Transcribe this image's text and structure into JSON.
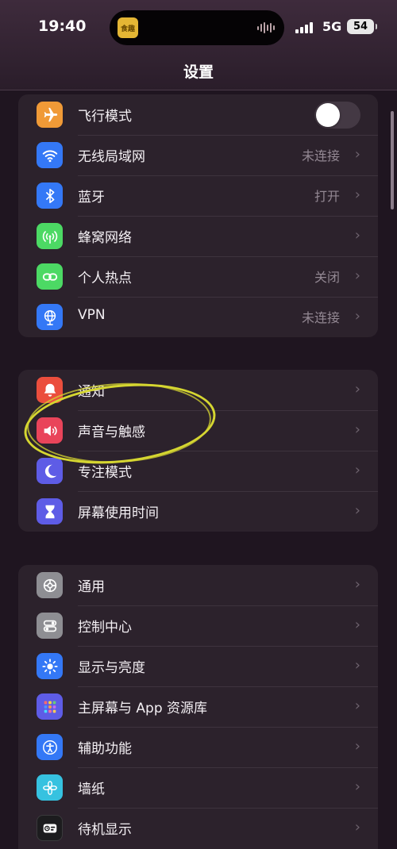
{
  "status_bar": {
    "time": "19:40",
    "island_app_label": "食趣",
    "network": "5G",
    "battery": "54"
  },
  "header": {
    "title": "设置"
  },
  "groups": [
    {
      "items": [
        {
          "label": "飞行模式",
          "icon": "airplane-icon",
          "color": "#f09a37",
          "toggle": false
        },
        {
          "label": "无线局域网",
          "value": "未连接",
          "icon": "wifi-icon",
          "color": "#3478f6"
        },
        {
          "label": "蓝牙",
          "value": "打开",
          "icon": "bluetooth-icon",
          "color": "#3478f6"
        },
        {
          "label": "蜂窝网络",
          "icon": "cellular-icon",
          "color": "#4cd964"
        },
        {
          "label": "个人热点",
          "value": "关闭",
          "icon": "hotspot-icon",
          "color": "#4cd964"
        },
        {
          "label": "VPN",
          "value": "未连接",
          "icon": "vpn-globe-icon",
          "color": "#3478f6"
        }
      ]
    },
    {
      "items": [
        {
          "label": "通知",
          "icon": "bell-icon",
          "color": "#eb4e3d"
        },
        {
          "label": "声音与触感",
          "icon": "speaker-icon",
          "color": "#e9445a"
        },
        {
          "label": "专注模式",
          "icon": "moon-icon",
          "color": "#5e5ce6"
        },
        {
          "label": "屏幕使用时间",
          "icon": "hourglass-icon",
          "color": "#5e5ce6"
        }
      ]
    },
    {
      "items": [
        {
          "label": "通用",
          "icon": "gear-icon",
          "color": "#8e8e93"
        },
        {
          "label": "控制中心",
          "icon": "control-center-icon",
          "color": "#8e8e93"
        },
        {
          "label": "显示与亮度",
          "icon": "sun-icon",
          "color": "#3478f6"
        },
        {
          "label": "主屏幕与 App 资源库",
          "icon": "home-screen-icon",
          "color": "#5e5ce6"
        },
        {
          "label": "辅助功能",
          "icon": "accessibility-icon",
          "color": "#3478f6"
        },
        {
          "label": "墙纸",
          "icon": "wallpaper-flower-icon",
          "color": "#36c2e0"
        },
        {
          "label": "待机显示",
          "icon": "standby-icon",
          "color": "#1c1c1e"
        }
      ]
    }
  ],
  "annotation": {
    "color": "#d5d631"
  }
}
